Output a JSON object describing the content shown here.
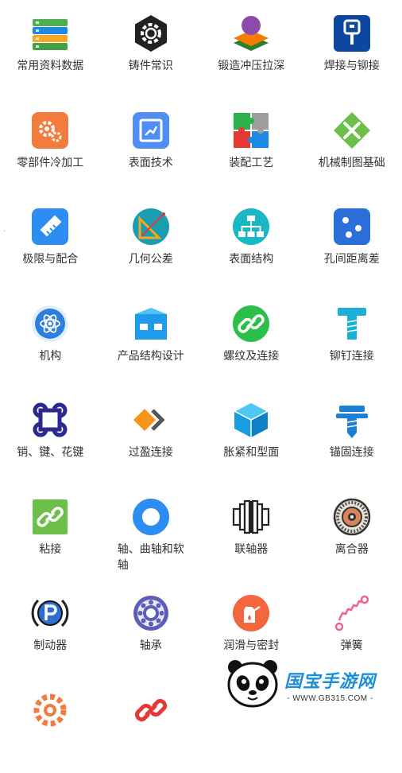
{
  "items": [
    {
      "label": "常用资料数据",
      "icon": "database-layers-icon"
    },
    {
      "label": "铸件常识",
      "icon": "gear-hexagon-icon"
    },
    {
      "label": "锻造冲压拉深",
      "icon": "forging-layers-icon"
    },
    {
      "label": "焊接与铆接",
      "icon": "welding-plug-icon"
    },
    {
      "label": "零部件冷加工",
      "icon": "gears-icon"
    },
    {
      "label": "表面技术",
      "icon": "surface-chart-icon"
    },
    {
      "label": "装配工艺",
      "icon": "puzzle-icon"
    },
    {
      "label": "机械制图基础",
      "icon": "tools-cross-icon"
    },
    {
      "label": "极限与配合",
      "icon": "ruler-icon"
    },
    {
      "label": "几何公差",
      "icon": "triangle-ruler-icon"
    },
    {
      "label": "表面结构",
      "icon": "hierarchy-icon"
    },
    {
      "label": "孔间距离差",
      "icon": "dice-dots-icon"
    },
    {
      "label": "机构",
      "icon": "atom-icon"
    },
    {
      "label": "产品结构设计",
      "icon": "product-box-icon"
    },
    {
      "label": "螺纹及连接",
      "icon": "link-circle-icon"
    },
    {
      "label": "铆钉连接",
      "icon": "rivet-icon"
    },
    {
      "label": "销、键、花键",
      "icon": "command-key-icon"
    },
    {
      "label": "过盈连接",
      "icon": "interference-fit-icon"
    },
    {
      "label": "胀紧和型面",
      "icon": "cube-icon"
    },
    {
      "label": "锚固连接",
      "icon": "anchor-bolt-icon"
    },
    {
      "label": "粘接",
      "icon": "link-square-icon"
    },
    {
      "label": "轴、曲轴和软轴",
      "icon": "ring-icon"
    },
    {
      "label": "联轴器",
      "icon": "coupling-icon"
    },
    {
      "label": "离合器",
      "icon": "clutch-disc-icon"
    },
    {
      "label": "制动器",
      "icon": "parking-brake-icon"
    },
    {
      "label": "轴承",
      "icon": "bearing-icon"
    },
    {
      "label": "润滑与密封",
      "icon": "oil-can-icon"
    },
    {
      "label": "弹簧",
      "icon": "spring-icon"
    },
    {
      "label": "",
      "icon": "gear-outline-icon"
    },
    {
      "label": "",
      "icon": "chain-link-icon"
    }
  ],
  "watermark": {
    "title": "国宝手游网",
    "url": "- WWW.GB315.COM -"
  },
  "colors": {
    "orange": "#f47b3e",
    "blue": "#2d8df0",
    "green": "#2bbf4a",
    "teal": "#1ab7c4",
    "navy": "#2c2a8c"
  }
}
